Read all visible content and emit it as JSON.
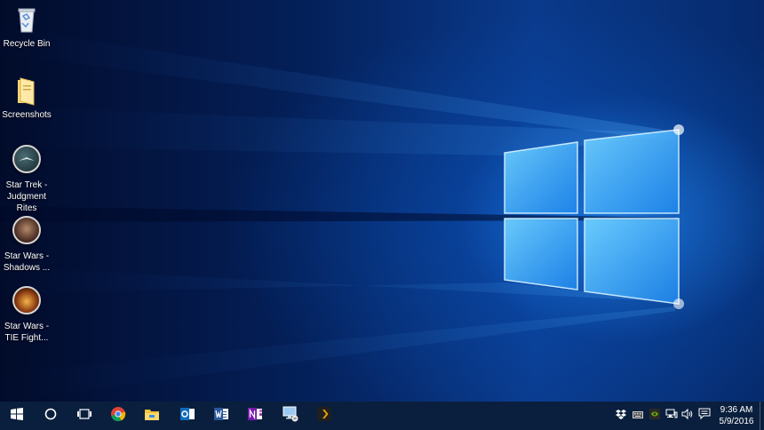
{
  "desktop": {
    "icons": [
      {
        "label": "Recycle Bin",
        "icon": "recycle-bin-icon"
      },
      {
        "label": "Screenshots",
        "icon": "folder-icon"
      },
      {
        "label": "Star Trek -\nJudgment\nRites",
        "icon": "star-trek-game-icon"
      },
      {
        "label": "Star Wars -\nShadows ...",
        "icon": "star-wars-shadows-game-icon"
      },
      {
        "label": "Star Wars -\nTIE Fight...",
        "icon": "star-wars-tie-fighter-game-icon"
      }
    ]
  },
  "taskbar": {
    "apps": [
      "start-icon",
      "cortana-icon",
      "task-view-icon",
      "chrome-icon",
      "file-explorer-icon",
      "outlook-icon",
      "word-icon",
      "onenote-icon",
      "remote-desktop-icon",
      "plex-icon"
    ],
    "tray": [
      "dropbox-icon",
      "keyboard-icon",
      "nvidia-icon",
      "network-icon",
      "volume-icon",
      "action-center-icon"
    ],
    "clock": {
      "time": "9:36 AM",
      "date": "5/9/2016"
    }
  },
  "colors": {
    "taskbar": "#0a1f3d",
    "wallpaper_glow": "#2896ff"
  }
}
